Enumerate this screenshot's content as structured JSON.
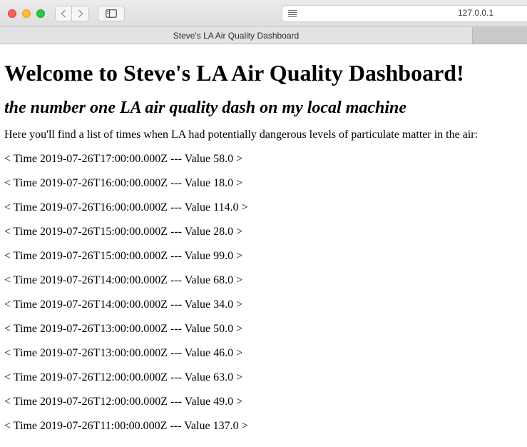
{
  "browser": {
    "url": "127.0.0.1",
    "tab_title": "Steve's LA Air Quality Dashboard",
    "icons": {
      "back": "chevron-left-icon",
      "forward": "chevron-right-icon",
      "sidebar": "sidebar-icon",
      "reader": "reader-icon"
    },
    "colors": {
      "close": "#fe5f57",
      "minimize": "#febc2e",
      "maximize": "#28c840"
    }
  },
  "page": {
    "heading": "Welcome to Steve's LA Air Quality Dashboard!",
    "subheading": "the number one LA air quality dash on my local machine",
    "intro": "Here you'll find a list of times when LA had potentially dangerous levels of particulate matter in the air:",
    "records": [
      "< Time 2019-07-26T17:00:00.000Z --- Value 58.0 >",
      "< Time 2019-07-26T16:00:00.000Z --- Value 18.0 >",
      "< Time 2019-07-26T16:00:00.000Z --- Value 114.0 >",
      "< Time 2019-07-26T15:00:00.000Z --- Value 28.0 >",
      "< Time 2019-07-26T15:00:00.000Z --- Value 99.0 >",
      "< Time 2019-07-26T14:00:00.000Z --- Value 68.0 >",
      "< Time 2019-07-26T14:00:00.000Z --- Value 34.0 >",
      "< Time 2019-07-26T13:00:00.000Z --- Value 50.0 >",
      "< Time 2019-07-26T13:00:00.000Z --- Value 46.0 >",
      "< Time 2019-07-26T12:00:00.000Z --- Value 63.0 >",
      "< Time 2019-07-26T12:00:00.000Z --- Value 49.0 >",
      "< Time 2019-07-26T11:00:00.000Z --- Value 137.0 >"
    ]
  }
}
